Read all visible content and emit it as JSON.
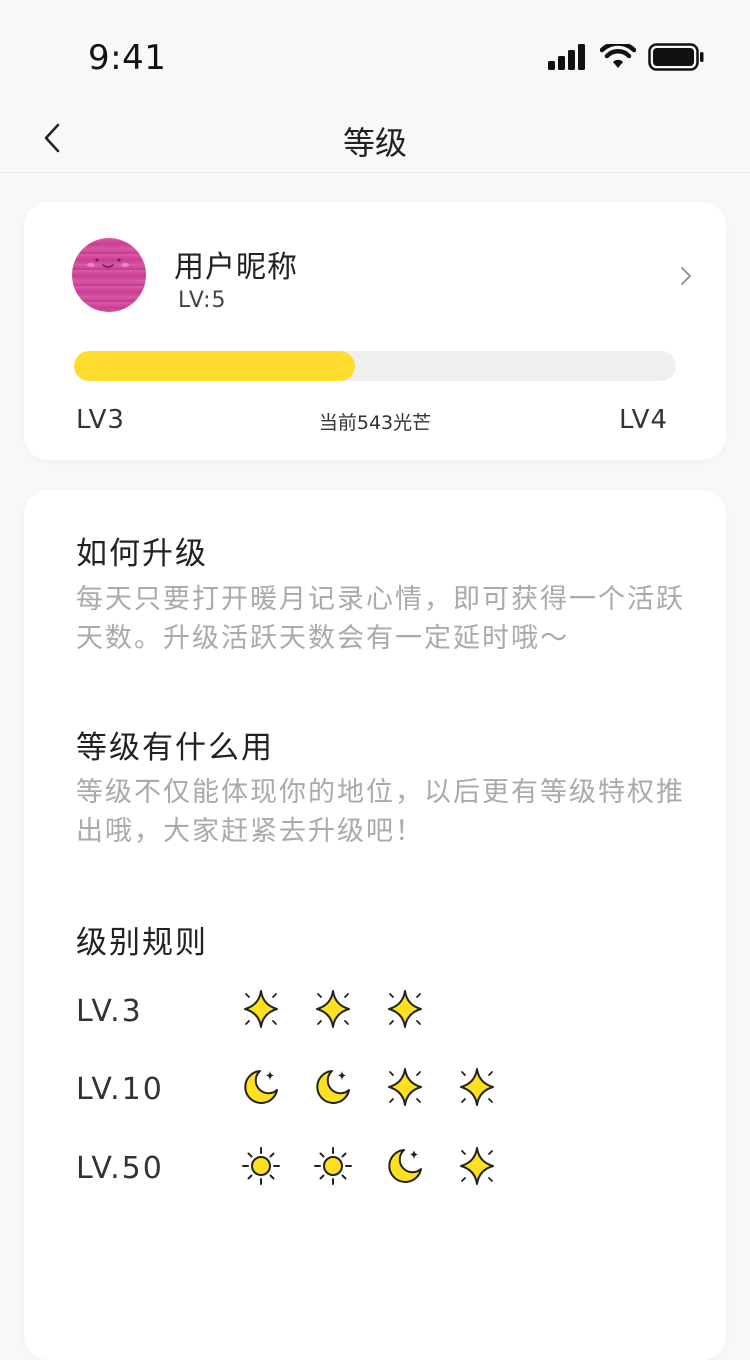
{
  "status_bar": {
    "time": "9:41"
  },
  "nav": {
    "title": "等级"
  },
  "profile": {
    "nickname": "用户昵称",
    "level": "LV:5",
    "progress_left": "LV3",
    "progress_right": "LV4",
    "current_points": "当前543光芒",
    "progress_fraction": 0.467
  },
  "sections": [
    {
      "title": "如何升级",
      "text": "每天只要打开暖月记录心情，即可获得一个活跃天数。升级活跃天数会有一定延时哦～"
    },
    {
      "title": "等级有什么用",
      "text": "等级不仅能体现你的地位，以后更有等级特权推出哦，大家赶紧去升级吧！"
    }
  ],
  "rules": {
    "title": "级别规则",
    "rows": [
      {
        "label": "LV.3",
        "icons": [
          "star-icon",
          "star-icon",
          "star-icon"
        ]
      },
      {
        "label": "LV.10",
        "icons": [
          "moon-icon",
          "moon-icon",
          "star-icon",
          "star-icon"
        ]
      },
      {
        "label": "LV.50",
        "icons": [
          "sun-icon",
          "sun-icon",
          "moon-icon",
          "star-icon"
        ]
      }
    ]
  },
  "colors": {
    "accent": "#FFDC2E",
    "icon_fill": "#FFE01F",
    "track": "#EFEFEF",
    "muted_text": "#AAAAAA",
    "page_bg": "#F7F8F8"
  }
}
